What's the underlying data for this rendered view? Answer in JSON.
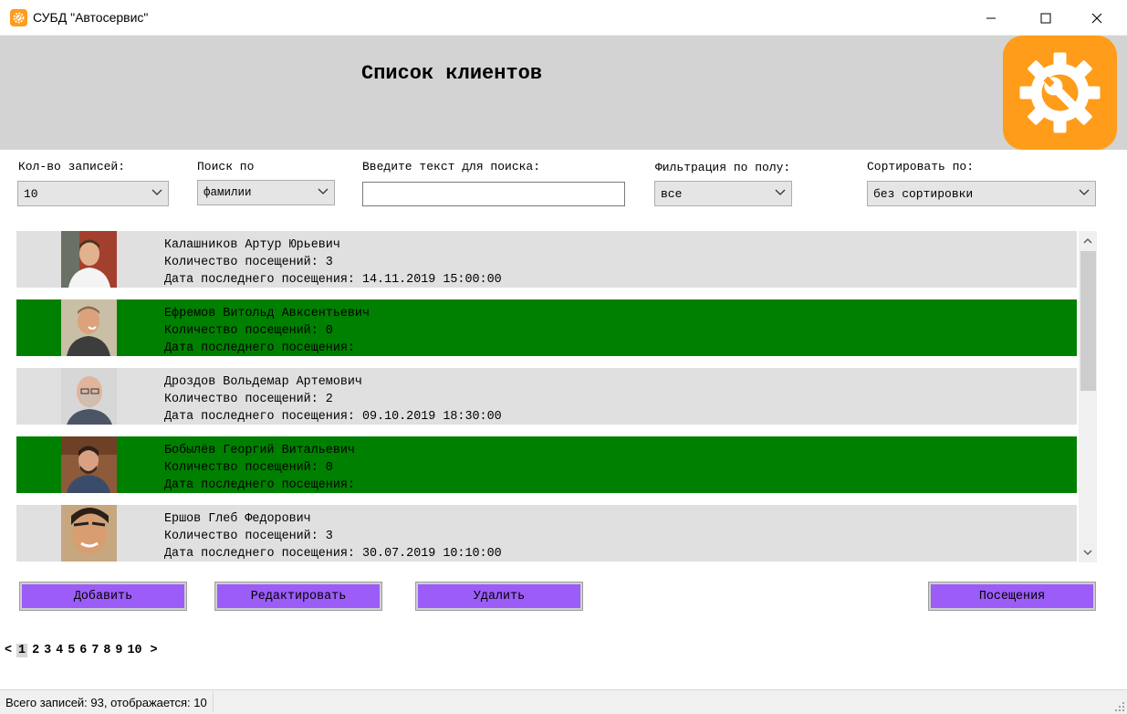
{
  "window": {
    "title": "СУБД \"Автосервис\"",
    "icon": "gear-wrench-icon",
    "controls": {
      "minimize": "─",
      "maximize": "☐",
      "close": "✕"
    }
  },
  "header": {
    "title": "Список клиентов",
    "logo": "gear-wrench-logo",
    "background": "#d3d3d3",
    "logo_color": "#ff9c1a"
  },
  "filters": {
    "count_label": "Кол-во записей:",
    "count_value": "10",
    "search_by_label": "Поиск по",
    "search_by_value": "фамилии",
    "search_text_label": "Введите текст для поиска:",
    "search_text_value": "",
    "gender_label": "Фильтрация по полу:",
    "gender_value": "все",
    "sort_label": "Сортировать по:",
    "sort_value": "без сортировки"
  },
  "clients": [
    {
      "name": "Калашников Артур Юрьевич",
      "visits_line": "Количество посещений: 3",
      "last_visit_line": "Дата последнего посещения: 14.11.2019 15:00:00",
      "highlight": false
    },
    {
      "name": "Ефремов Витольд Авксентьевич",
      "visits_line": "Количество посещений: 0",
      "last_visit_line": "Дата последнего посещения:",
      "highlight": true
    },
    {
      "name": "Дроздов Вольдемар Артемович",
      "visits_line": "Количество посещений: 2",
      "last_visit_line": "Дата последнего посещения: 09.10.2019 18:30:00",
      "highlight": false
    },
    {
      "name": "Бобылёв Георгий Витальевич",
      "visits_line": "Количество посещений: 0",
      "last_visit_line": "Дата последнего посещения:",
      "highlight": true
    },
    {
      "name": "Ершов Глеб Федорович",
      "visits_line": "Количество посещений: 3",
      "last_visit_line": "Дата последнего посещения: 30.07.2019 10:10:00",
      "highlight": false
    }
  ],
  "colors": {
    "row_normal": "#e0e0e0",
    "row_highlight": "#008000",
    "button": "#9b5cf8"
  },
  "buttons": {
    "add": "Добавить",
    "edit": "Редактировать",
    "delete": "Удалить",
    "visits": "Посещения"
  },
  "pager": {
    "prev": "<",
    "pages": [
      "1",
      "2",
      "3",
      "4",
      "5",
      "6",
      "7",
      "8",
      "9",
      "10"
    ],
    "current": "1",
    "next": ">"
  },
  "status": {
    "text": "Всего записей: 93, отображается: 10"
  }
}
